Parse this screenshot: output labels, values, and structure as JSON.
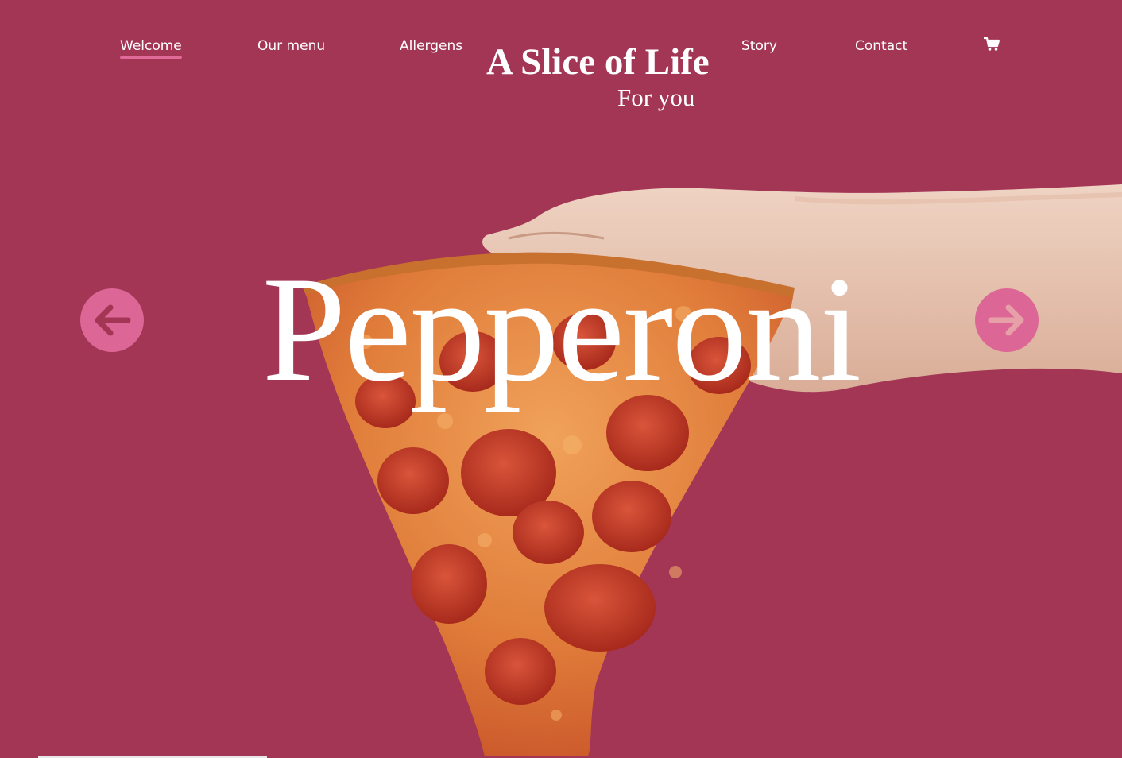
{
  "nav": {
    "items": [
      {
        "label": "Welcome",
        "active": true
      },
      {
        "label": "Our menu",
        "active": false
      },
      {
        "label": "Allergens",
        "active": false
      },
      {
        "label": "Story",
        "active": false
      },
      {
        "label": "Contact",
        "active": false
      }
    ],
    "cart_icon": "shopping-cart-icon"
  },
  "brand": {
    "title": "A Slice of Life",
    "tagline": "For you"
  },
  "hero": {
    "title": "Pepperoni",
    "image": "pepperoni-pizza-slice-held-by-hand",
    "prev_icon": "arrow-left-icon",
    "next_icon": "arrow-right-icon"
  },
  "colors": {
    "background": "#a33555",
    "accent": "#dc6796",
    "text": "#ffffff"
  }
}
